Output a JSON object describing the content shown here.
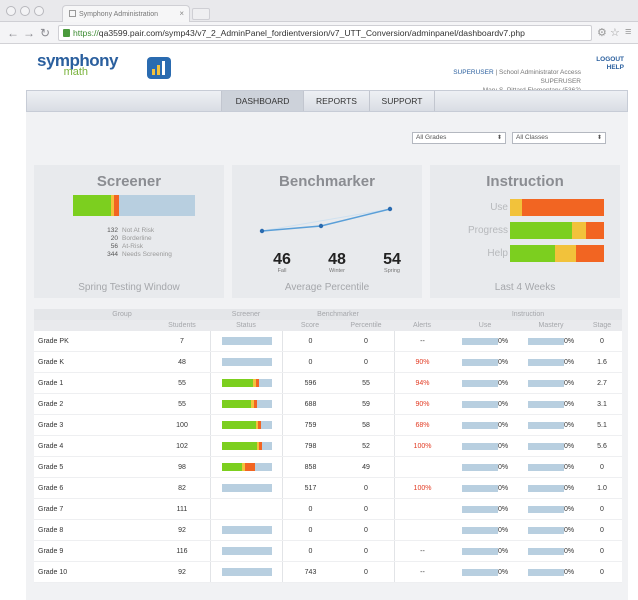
{
  "browser": {
    "tab_title": "Symphony Administration",
    "url_scheme": "https://",
    "url_rest": "qa3599.pair.com/symp43/v7_2_AdminPanel_fordientversion/v7_UTT_Conversion/adminpanel/dashboardv7.php"
  },
  "header": {
    "logo_title": "symphony",
    "logo_sub": "math",
    "user_role": "SUPERUSER",
    "user_line1_rest": " | School Administrator Access",
    "user_line2": "SUPERUSER",
    "user_line3": "Mary S. Pittard Elementary (5362)",
    "logout": "LOGOUT",
    "help": "HELP"
  },
  "nav": {
    "dashboard": "DASHBOARD",
    "reports": "REPORTS",
    "support": "SUPPORT"
  },
  "filters": {
    "grades": "All Grades",
    "classes": "All Classes"
  },
  "screener": {
    "title": "Screener",
    "segments": [
      {
        "color": "#7ccf1f",
        "fraction": 0.31
      },
      {
        "color": "#f2c23b",
        "fraction": 0.03
      },
      {
        "color": "#f26522",
        "fraction": 0.04
      },
      {
        "color": "#b8cfe0",
        "fraction": 0.62
      }
    ],
    "legend": [
      {
        "num": "132",
        "label": "Not At Risk"
      },
      {
        "num": "20",
        "label": "Borderline"
      },
      {
        "num": "56",
        "label": "At-Risk"
      },
      {
        "num": "344",
        "label": "Needs Screening"
      }
    ],
    "footer": "Spring Testing Window"
  },
  "benchmarker": {
    "title": "Benchmarker",
    "stats": [
      {
        "value": "46",
        "label": "Fall"
      },
      {
        "value": "48",
        "label": "Winter"
      },
      {
        "value": "54",
        "label": "Spring"
      }
    ],
    "footer": "Average Percentile"
  },
  "instruction": {
    "title": "Instruction",
    "rows": [
      {
        "label": "Use",
        "segments": [
          {
            "color": "#f2c23b",
            "fraction": 0.13
          },
          {
            "color": "#f26522",
            "fraction": 0.87
          }
        ]
      },
      {
        "label": "Progress",
        "segments": [
          {
            "color": "#7ccf1f",
            "fraction": 0.66
          },
          {
            "color": "#f2c23b",
            "fraction": 0.15
          },
          {
            "color": "#f26522",
            "fraction": 0.19
          }
        ]
      },
      {
        "label": "Help",
        "segments": [
          {
            "color": "#7ccf1f",
            "fraction": 0.48
          },
          {
            "color": "#f2c23b",
            "fraction": 0.22
          },
          {
            "color": "#f26522",
            "fraction": 0.3
          }
        ]
      }
    ],
    "footer": "Last 4 Weeks"
  },
  "table": {
    "group_headers": {
      "group": "Group",
      "screener": "Screener",
      "benchmarker": "Benchmarker",
      "instruction": "Instruction"
    },
    "columns": {
      "students": "Students",
      "status": "Status",
      "score": "Score",
      "percentile": "Percentile",
      "alerts": "Alerts",
      "use": "Use",
      "mastery": "Mastery",
      "stage": "Stage"
    },
    "rows": [
      {
        "grade": "Grade PK",
        "students": "7",
        "status": [
          0,
          0,
          0,
          1
        ],
        "score": "0",
        "percentile": "0",
        "alerts": "--",
        "alerts_red": false,
        "use": "0%",
        "mastery": "0%",
        "stage": "0"
      },
      {
        "grade": "Grade K",
        "students": "48",
        "status": [
          0,
          0,
          0,
          1
        ],
        "score": "0",
        "percentile": "0",
        "alerts": "90%",
        "alerts_red": true,
        "use": "0%",
        "mastery": "0%",
        "stage": "1.6"
      },
      {
        "grade": "Grade 1",
        "students": "55",
        "status": [
          0.62,
          0.06,
          0.07,
          0.25
        ],
        "score": "596",
        "percentile": "55",
        "alerts": "94%",
        "alerts_red": true,
        "use": "0%",
        "mastery": "0%",
        "stage": "2.7"
      },
      {
        "grade": "Grade 2",
        "students": "55",
        "status": [
          0.58,
          0.06,
          0.06,
          0.3
        ],
        "score": "688",
        "percentile": "59",
        "alerts": "90%",
        "alerts_red": true,
        "use": "0%",
        "mastery": "0%",
        "stage": "3.1"
      },
      {
        "grade": "Grade 3",
        "students": "100",
        "status": [
          0.68,
          0.04,
          0.06,
          0.22
        ],
        "score": "759",
        "percentile": "58",
        "alerts": "68%",
        "alerts_red": true,
        "use": "0%",
        "mastery": "0%",
        "stage": "5.1"
      },
      {
        "grade": "Grade 4",
        "students": "102",
        "status": [
          0.7,
          0.04,
          0.06,
          0.2
        ],
        "score": "798",
        "percentile": "52",
        "alerts": "100%",
        "alerts_red": true,
        "use": "0%",
        "mastery": "0%",
        "stage": "5.6"
      },
      {
        "grade": "Grade 5",
        "students": "98",
        "status": [
          0.4,
          0.06,
          0.2,
          0.34
        ],
        "score": "858",
        "percentile": "49",
        "alerts": "",
        "alerts_red": false,
        "use": "0%",
        "mastery": "0%",
        "stage": "0"
      },
      {
        "grade": "Grade 6",
        "students": "82",
        "status": [
          0,
          0,
          0,
          1
        ],
        "score": "517",
        "percentile": "0",
        "alerts": "100%",
        "alerts_red": true,
        "use": "0%",
        "mastery": "0%",
        "stage": "1.0"
      },
      {
        "grade": "Grade 7",
        "students": "111",
        "status": [
          0,
          0,
          0,
          0
        ],
        "score": "0",
        "percentile": "0",
        "alerts": "",
        "alerts_red": false,
        "use": "0%",
        "mastery": "0%",
        "stage": "0"
      },
      {
        "grade": "Grade 8",
        "students": "92",
        "status": [
          0,
          0,
          0,
          1
        ],
        "score": "0",
        "percentile": "0",
        "alerts": "",
        "alerts_red": false,
        "use": "0%",
        "mastery": "0%",
        "stage": "0"
      },
      {
        "grade": "Grade 9",
        "students": "116",
        "status": [
          0,
          0,
          0,
          1
        ],
        "score": "0",
        "percentile": "0",
        "alerts": "--",
        "alerts_red": false,
        "use": "0%",
        "mastery": "0%",
        "stage": "0"
      },
      {
        "grade": "Grade 10",
        "students": "92",
        "status": [
          0,
          0,
          0,
          1
        ],
        "score": "743",
        "percentile": "0",
        "alerts": "--",
        "alerts_red": false,
        "use": "0%",
        "mastery": "0%",
        "stage": "0"
      }
    ]
  },
  "colors": {
    "green": "#7ccf1f",
    "yellow": "#f2c23b",
    "orange": "#f26522",
    "blue_gray": "#b8cfe0",
    "line": "#5a9fd8"
  }
}
